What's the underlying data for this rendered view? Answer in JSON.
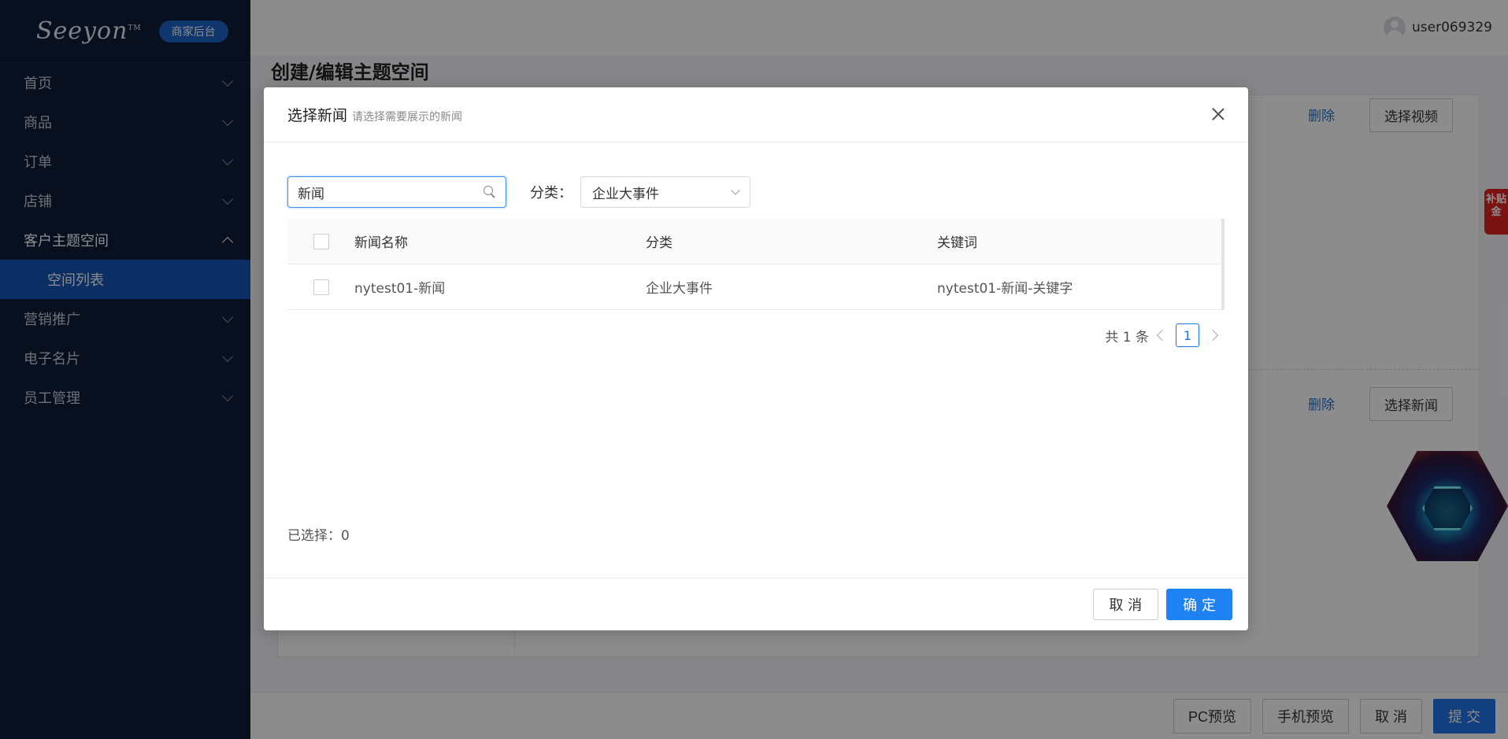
{
  "sidebar": {
    "logo": "Seeyon",
    "logo_tm": "TM",
    "badge": "商家后台",
    "items": [
      {
        "label": "首页"
      },
      {
        "label": "商品"
      },
      {
        "label": "订单"
      },
      {
        "label": "店铺"
      },
      {
        "label": "客户主题空间"
      },
      {
        "label": "营销推广"
      },
      {
        "label": "电子名片"
      },
      {
        "label": "员工管理"
      }
    ],
    "submenu": {
      "label": "空间列表"
    }
  },
  "topbar": {
    "username": "user069329"
  },
  "page": {
    "title": "创建/编辑主题空间",
    "delete_1": "删除",
    "select_video": "选择视频",
    "delete_2": "删除",
    "select_news": "选择新闻",
    "side_tag": "补贴金"
  },
  "footer": {
    "pc_preview": "PC预览",
    "mobile_preview": "手机预览",
    "cancel": "取 消",
    "submit": "提 交"
  },
  "modal": {
    "title": "选择新闻",
    "subtitle": "请选择需要展示的新闻",
    "search": {
      "value": "新闻",
      "placeholder": ""
    },
    "category_label": "分类：",
    "category_value": "企业大事件",
    "columns": {
      "name": "新闻名称",
      "category": "分类",
      "keywords": "关键词"
    },
    "rows": [
      {
        "name": "nytest01-新闻",
        "category": "企业大事件",
        "keywords": "nytest01-新闻-关键字"
      }
    ],
    "pagination": {
      "total": "共 1 条",
      "current": "1"
    },
    "selected_count": "已选择：0",
    "cancel": "取 消",
    "confirm": "确 定"
  },
  "colors": {
    "sidebar_bg": "#0f1d3a",
    "active_item": "#1456b8",
    "primary": "#1f82f2"
  }
}
